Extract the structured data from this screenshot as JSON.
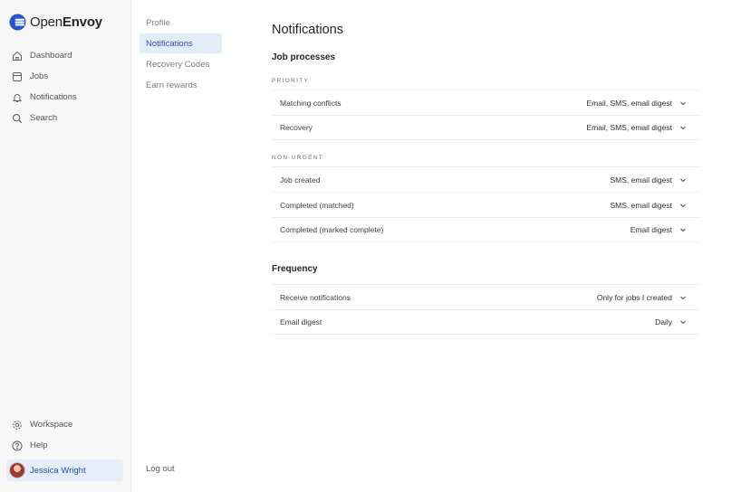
{
  "brand": {
    "name_light": "Open",
    "name_bold": "Envoy"
  },
  "nav": [
    {
      "label": "Dashboard",
      "icon": "home-icon"
    },
    {
      "label": "Jobs",
      "icon": "jobs-icon"
    },
    {
      "label": "Notifications",
      "icon": "bell-icon"
    },
    {
      "label": "Search",
      "icon": "search-icon"
    }
  ],
  "bottom_nav": [
    {
      "label": "Workspace",
      "icon": "gear-icon"
    },
    {
      "label": "Help",
      "icon": "help-icon"
    }
  ],
  "user": {
    "name": "Jessica Wright"
  },
  "settings_nav": [
    {
      "label": "Profile",
      "active": false
    },
    {
      "label": "Notifications",
      "active": true
    },
    {
      "label": "Recovery Codes",
      "active": false
    },
    {
      "label": "Earn rewards",
      "active": false
    }
  ],
  "logout_label": "Log out",
  "page": {
    "title": "Notifications",
    "job_processes": {
      "title": "Job processes",
      "priority": {
        "label": "PRIORITY",
        "rows": [
          {
            "label": "Matching conflicts",
            "value": "Email, SMS, email digest"
          },
          {
            "label": "Recovery",
            "value": "Email, SMS, email digest"
          }
        ]
      },
      "non_urgent": {
        "label": "NON-URGENT",
        "rows": [
          {
            "label": "Job created",
            "value": "SMS, email digest"
          },
          {
            "label": "Completed (matched)",
            "value": "SMS, email digest"
          },
          {
            "label": "Completed (marked complete)",
            "value": "Email digest"
          }
        ]
      }
    },
    "frequency": {
      "title": "Frequency",
      "rows": [
        {
          "label": "Receive notifications",
          "value": "Only for jobs I created"
        },
        {
          "label": "Email digest",
          "value": "Daily"
        }
      ]
    }
  },
  "colors": {
    "accent": "#2355b6",
    "active_bg": "#e3ecf9",
    "sidebar_bg": "#f7f7f8"
  }
}
